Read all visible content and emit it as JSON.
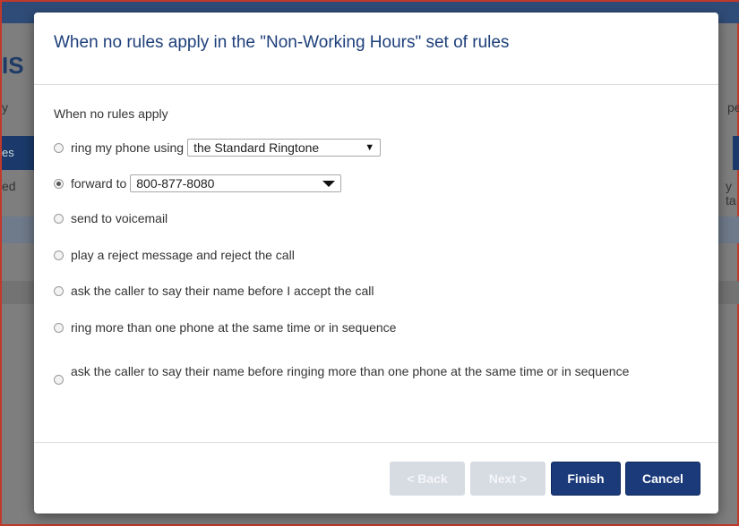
{
  "background": {
    "title_fragment": "IS",
    "text_left": "y",
    "text_right": "pe",
    "button_fragment": "es",
    "text_left2": "ed",
    "text_right2": "y ta"
  },
  "dialog": {
    "title": "When no rules apply in the \"Non-Working Hours\" set of rules",
    "section_label": "When no rules apply",
    "options": {
      "ring": {
        "label": "ring my phone using",
        "select_value": "the Standard Ringtone",
        "checked": false
      },
      "forward": {
        "label": "forward to",
        "select_value": "800-877-8080",
        "checked": true
      },
      "voicemail": {
        "label": "send to voicemail",
        "checked": false
      },
      "reject": {
        "label": "play a reject message and reject the call",
        "checked": false
      },
      "announce": {
        "label": "ask the caller to say their name before I accept the call",
        "checked": false
      },
      "multi_ring": {
        "label": "ring more than one phone at the same time or in sequence",
        "checked": false
      },
      "announce_multi": {
        "label": "ask the caller to say their name before ringing more than one phone at the same time or in sequence",
        "checked": false
      }
    },
    "buttons": {
      "back": "< Back",
      "next": "Next >",
      "finish": "Finish",
      "cancel": "Cancel"
    }
  },
  "colors": {
    "accent": "#1b3a7a",
    "title": "#1d3f7a",
    "disabled_button": "#d7dbe2",
    "overlay_border": "#c0392b"
  }
}
